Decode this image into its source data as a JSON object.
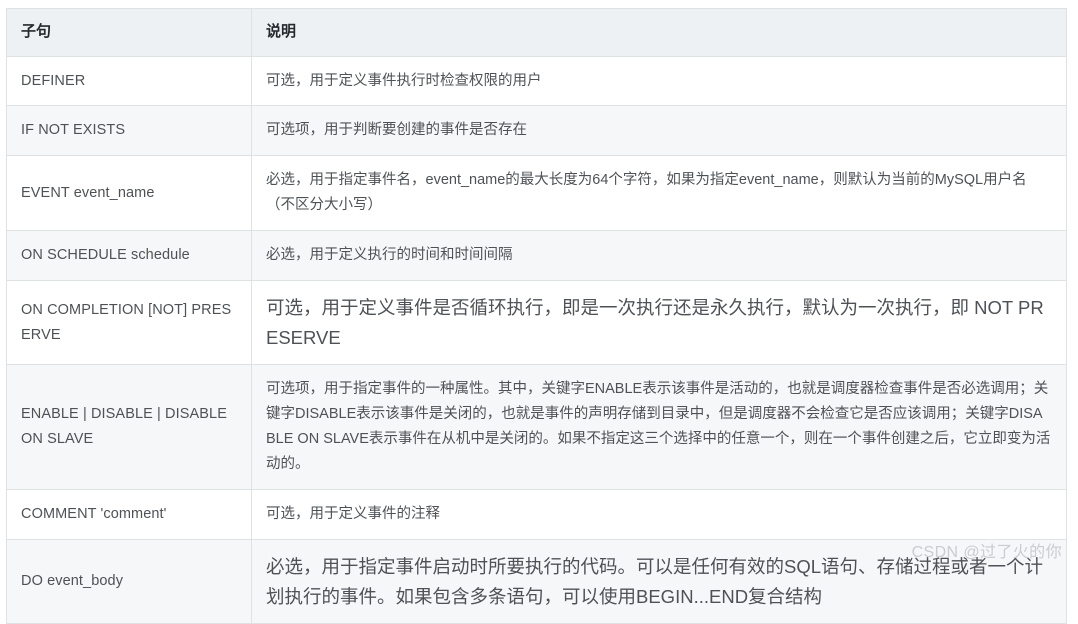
{
  "table": {
    "headers": {
      "clause": "子句",
      "description": "说明"
    },
    "rows": [
      {
        "clause": "DEFINER",
        "description": "可选，用于定义事件执行时检查权限的用户",
        "size": "normal"
      },
      {
        "clause": "IF NOT EXISTS",
        "description": "可选项，用于判断要创建的事件是否存在",
        "size": "normal"
      },
      {
        "clause": "EVENT event_name",
        "description": "必选，用于指定事件名，event_name的最大长度为64个字符，如果为指定event_name，则默认为当前的MySQL用户名（不区分大小写）",
        "size": "normal"
      },
      {
        "clause": "ON SCHEDULE schedule",
        "description": "必选，用于定义执行的时间和时间间隔",
        "size": "normal"
      },
      {
        "clause": "ON COMPLETION [NOT] PRESERVE",
        "description": "可选，用于定义事件是否循环执行，即是一次执行还是永久执行，默认为一次执行，即 NOT PRESERVE",
        "size": "large"
      },
      {
        "clause": "ENABLE | DISABLE | DISABLE ON SLAVE",
        "description": "可选项，用于指定事件的一种属性。其中，关键字ENABLE表示该事件是活动的，也就是调度器检查事件是否必选调用；关键字DISABLE表示该事件是关闭的，也就是事件的声明存储到目录中，但是调度器不会检查它是否应该调用；关键字DISABLE ON SLAVE表示事件在从机中是关闭的。如果不指定这三个选择中的任意一个，则在一个事件创建之后，它立即变为活动的。",
        "size": "normal"
      },
      {
        "clause": "COMMENT 'comment'",
        "description": "可选，用于定义事件的注释",
        "size": "normal"
      },
      {
        "clause": "DO event_body",
        "description": "必选，用于指定事件启动时所要执行的代码。可以是任何有效的SQL语句、存储过程或者一个计划执行的事件。如果包含多条语句，可以使用BEGIN...END复合结构",
        "size": "large"
      }
    ]
  },
  "watermark": {
    "text": "CSDN @过了火的你"
  },
  "colors": {
    "border": "#dfe2e5",
    "header_background": "#eef1f4",
    "header_text": "#24292e",
    "body_text": "#4e5256",
    "stripe_background": "#f6f7f8",
    "watermark_text": "#c9ccd0"
  }
}
